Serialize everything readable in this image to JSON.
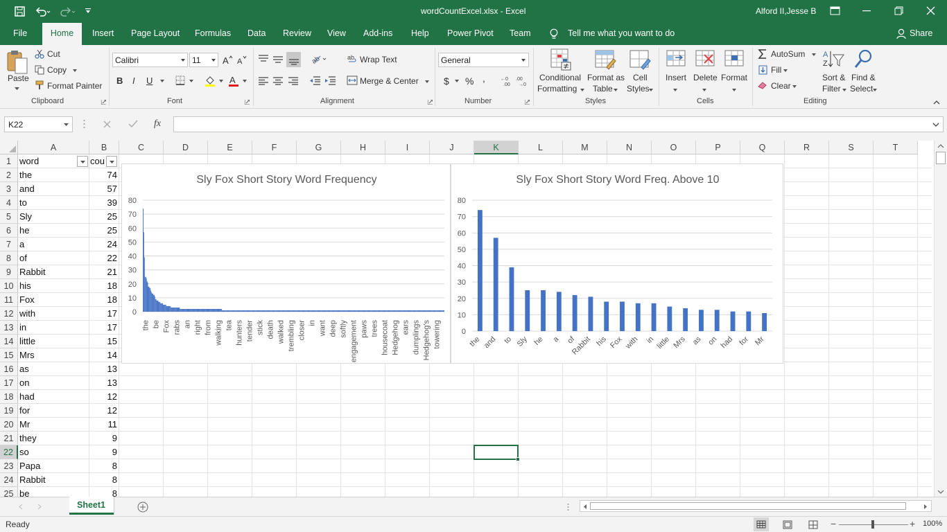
{
  "window": {
    "title": "wordCountExcel.xlsx  -  Excel",
    "user": "Alford II,Jesse B"
  },
  "tabs": [
    "File",
    "Home",
    "Insert",
    "Page Layout",
    "Formulas",
    "Data",
    "Review",
    "View",
    "Add-ins",
    "Help",
    "Power Pivot",
    "Team"
  ],
  "tell_me": "Tell me what you want to do",
  "share": "Share",
  "ribbon": {
    "clipboard": {
      "paste": "Paste",
      "cut": "Cut",
      "copy": "Copy",
      "format_painter": "Format Painter",
      "group": "Clipboard"
    },
    "font": {
      "name": "Calibri",
      "size": "11",
      "group": "Font",
      "bold": "B",
      "italic": "I",
      "underline": "U"
    },
    "alignment": {
      "wrap_text": "Wrap Text",
      "merge_center": "Merge & Center",
      "group": "Alignment"
    },
    "number": {
      "format": "General",
      "currency": "$",
      "percent": "%",
      "comma": ",",
      "group": "Number"
    },
    "styles": {
      "conditional": "Conditional",
      "conditional2": "Formatting",
      "format_as": "Format as",
      "format_as2": "Table",
      "cell": "Cell",
      "cell2": "Styles",
      "group": "Styles"
    },
    "cells": {
      "insert": "Insert",
      "delete": "Delete",
      "format": "Format",
      "group": "Cells"
    },
    "editing": {
      "autosum": "AutoSum",
      "fill": "Fill",
      "clear": "Clear",
      "sort": "Sort &",
      "sort2": "Filter",
      "find": "Find &",
      "find2": "Select",
      "group": "Editing"
    }
  },
  "formula_bar": {
    "name_box": "K22",
    "fx": "fx",
    "formula": ""
  },
  "columns": [
    "A",
    "B",
    "C",
    "D",
    "E",
    "F",
    "G",
    "H",
    "I",
    "J",
    "K",
    "L",
    "M",
    "N",
    "O",
    "P",
    "Q",
    "R",
    "S",
    "T"
  ],
  "rows": [
    {
      "n": "1",
      "word": "word",
      "count": "cou"
    },
    {
      "n": "2",
      "word": "the",
      "count": "74"
    },
    {
      "n": "3",
      "word": "and",
      "count": "57"
    },
    {
      "n": "4",
      "word": "to",
      "count": "39"
    },
    {
      "n": "5",
      "word": "Sly",
      "count": "25"
    },
    {
      "n": "6",
      "word": "he",
      "count": "25"
    },
    {
      "n": "7",
      "word": "a",
      "count": "24"
    },
    {
      "n": "8",
      "word": "of",
      "count": "22"
    },
    {
      "n": "9",
      "word": "Rabbit",
      "count": "21"
    },
    {
      "n": "10",
      "word": "his",
      "count": "18"
    },
    {
      "n": "11",
      "word": "Fox",
      "count": "18"
    },
    {
      "n": "12",
      "word": "with",
      "count": "17"
    },
    {
      "n": "13",
      "word": "in",
      "count": "17"
    },
    {
      "n": "14",
      "word": "little",
      "count": "15"
    },
    {
      "n": "15",
      "word": "Mrs",
      "count": "14"
    },
    {
      "n": "16",
      "word": "as",
      "count": "13"
    },
    {
      "n": "17",
      "word": "on",
      "count": "13"
    },
    {
      "n": "18",
      "word": "had",
      "count": "12"
    },
    {
      "n": "19",
      "word": "for",
      "count": "12"
    },
    {
      "n": "20",
      "word": "Mr",
      "count": "11"
    },
    {
      "n": "21",
      "word": "they",
      "count": "9"
    },
    {
      "n": "22",
      "word": "so",
      "count": "9"
    },
    {
      "n": "23",
      "word": "Papa",
      "count": "8"
    },
    {
      "n": "24",
      "word": "Rabbit",
      "count": "8"
    },
    {
      "n": "25",
      "word": "be",
      "count": "8"
    }
  ],
  "sheet_tab": "Sheet1",
  "status": {
    "ready": "Ready",
    "zoom": "100%"
  },
  "colors": {
    "excel_green": "#217346",
    "bar_blue": "#4472c4"
  },
  "chart_data": [
    {
      "type": "bar",
      "title": "Sly Fox Short Story Word Frequency",
      "ylim": [
        0,
        80
      ],
      "yticks": [
        0,
        10,
        20,
        30,
        40,
        50,
        60,
        70,
        80
      ],
      "tick_labels": [
        "the",
        "be",
        "Fox",
        "rabs",
        "an",
        "right",
        "from",
        "walking",
        "tea",
        "hunters",
        "tender",
        "stick",
        "death",
        "walked",
        "trembling",
        "closer",
        "in",
        "want",
        "deep",
        "softly",
        "engagement",
        "paws",
        "trees",
        "housecoat",
        "Hedgehog",
        "ears",
        "dumplings",
        "Hedgehog's",
        "towering"
      ],
      "values": [
        74,
        57,
        39,
        25,
        25,
        24,
        22,
        21,
        18,
        18,
        17,
        17,
        15,
        14,
        13,
        13,
        12,
        12,
        11,
        9,
        9,
        8,
        8,
        8,
        7,
        7,
        7,
        6,
        6,
        6,
        6,
        5,
        5,
        5,
        5,
        5,
        4,
        4,
        4,
        4,
        4,
        4,
        4,
        3,
        3,
        3,
        3,
        3,
        3,
        3,
        3,
        3,
        3,
        3,
        3,
        3,
        3,
        2,
        2,
        2,
        2,
        2,
        2,
        2,
        2,
        2,
        2,
        2,
        2,
        2,
        2,
        2,
        2,
        2,
        2,
        2,
        2,
        2,
        2,
        2,
        2,
        2,
        2,
        2,
        2,
        2,
        2,
        2,
        2,
        2,
        2,
        2,
        2,
        2,
        2,
        2,
        2,
        2,
        2,
        2,
        2,
        2,
        2,
        2,
        2,
        2,
        2,
        2,
        2,
        2,
        2,
        2,
        2,
        2,
        2,
        2,
        2,
        2,
        2,
        2,
        2,
        2,
        1,
        1,
        1,
        1,
        1,
        1,
        1,
        1,
        1,
        1,
        1,
        1,
        1,
        1,
        1,
        1,
        1,
        1,
        1,
        1,
        1,
        1,
        1,
        1,
        1,
        1,
        1,
        1,
        1,
        1,
        1,
        1,
        1,
        1,
        1,
        1,
        1,
        1,
        1,
        1,
        1,
        1,
        1,
        1,
        1,
        1,
        1,
        1,
        1,
        1,
        1,
        1,
        1,
        1,
        1,
        1,
        1,
        1,
        1,
        1,
        1,
        1,
        1,
        1,
        1,
        1,
        1,
        1,
        1,
        1,
        1,
        1,
        1,
        1,
        1,
        1,
        1,
        1,
        1,
        1,
        1,
        1,
        1,
        1,
        1,
        1,
        1,
        1,
        1,
        1,
        1,
        1,
        1,
        1,
        1,
        1,
        1,
        1,
        1,
        1,
        1,
        1,
        1,
        1,
        1,
        1,
        1,
        1,
        1,
        1,
        1,
        1,
        1,
        1,
        1,
        1,
        1,
        1,
        1,
        1,
        1,
        1,
        1,
        1,
        1,
        1,
        1,
        1,
        1,
        1,
        1,
        1,
        1,
        1,
        1,
        1,
        1,
        1,
        1,
        1,
        1,
        1,
        1,
        1,
        1,
        1,
        1,
        1,
        1,
        1,
        1,
        1,
        1,
        1,
        1,
        1,
        1,
        1,
        1,
        1,
        1,
        1,
        1,
        1,
        1,
        1,
        1,
        1,
        1,
        1,
        1,
        1,
        1,
        1,
        1,
        1,
        1,
        1,
        1,
        1,
        1,
        1,
        1,
        1,
        1,
        1,
        1,
        1,
        1,
        1,
        1,
        1,
        1,
        1,
        1,
        1,
        1,
        1,
        1,
        1,
        1,
        1,
        1,
        1,
        1,
        1,
        1,
        1,
        1,
        1,
        1,
        1,
        1,
        1,
        1,
        1,
        1,
        1,
        1,
        1,
        1,
        1,
        1,
        1,
        1,
        1,
        1,
        1,
        1,
        1,
        1,
        1,
        1,
        1,
        1,
        1,
        1,
        1,
        1,
        1,
        1,
        1,
        1,
        1,
        1,
        1,
        1,
        1,
        1,
        1,
        1,
        1,
        1,
        1,
        1,
        1,
        1,
        1,
        1,
        1,
        1,
        1,
        1,
        1,
        1,
        1,
        1,
        1,
        1,
        1,
        1,
        1,
        1,
        1,
        1,
        1,
        1,
        1,
        1,
        1,
        1,
        1,
        1,
        1,
        1,
        1,
        1,
        1,
        1,
        1,
        1,
        1,
        1,
        1,
        1,
        1,
        1,
        1,
        1,
        1,
        1,
        1,
        1,
        1,
        1,
        1,
        1,
        1,
        1,
        1,
        1,
        1,
        1,
        1,
        1,
        1,
        1,
        1,
        1,
        1,
        1,
        1,
        1,
        1,
        1,
        1,
        1,
        1,
        1,
        1,
        1,
        1,
        1,
        1,
        1,
        1,
        1,
        1,
        1,
        1,
        1,
        1,
        1
      ],
      "grid": true,
      "legend": "none"
    },
    {
      "type": "bar",
      "title": "Sly Fox Short Story Word Freq. Above 10",
      "ylim": [
        0,
        80
      ],
      "yticks": [
        0,
        10,
        20,
        30,
        40,
        50,
        60,
        70,
        80
      ],
      "categories": [
        "the",
        "and",
        "to",
        "Sly",
        "he",
        "a",
        "of",
        "Rabbit",
        "his",
        "Fox",
        "with",
        "in",
        "little",
        "Mrs",
        "as",
        "on",
        "had",
        "for",
        "Mr"
      ],
      "values": [
        74,
        57,
        39,
        25,
        25,
        24,
        22,
        21,
        18,
        18,
        17,
        17,
        15,
        14,
        13,
        13,
        12,
        12,
        11
      ],
      "grid": true,
      "legend": "none"
    }
  ]
}
